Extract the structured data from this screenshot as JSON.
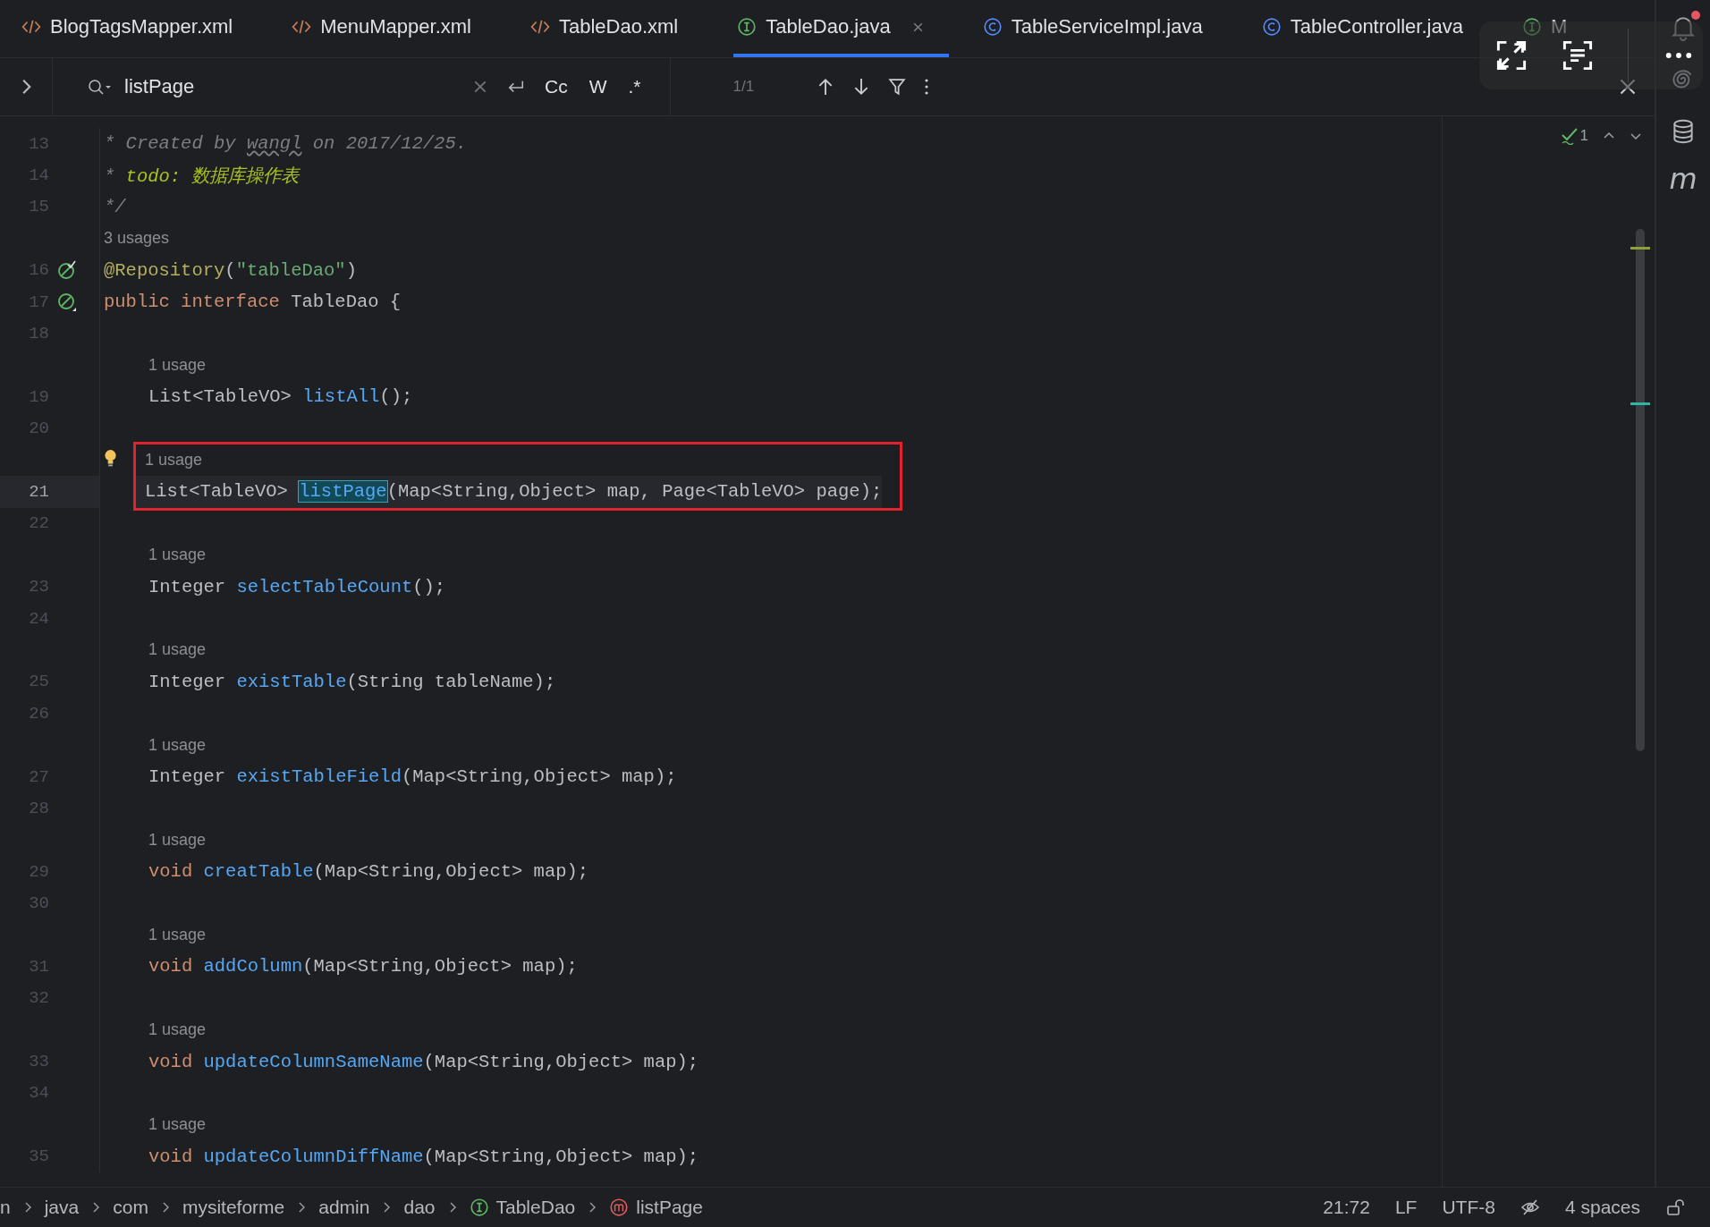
{
  "tabs": [
    {
      "label": "BlogTagsMapper.xml",
      "kind": "xml",
      "selected": false
    },
    {
      "label": "MenuMapper.xml",
      "kind": "xml",
      "selected": false
    },
    {
      "label": "TableDao.xml",
      "kind": "xml",
      "selected": false
    },
    {
      "label": "TableDao.java",
      "kind": "interface",
      "selected": true
    },
    {
      "label": "TableServiceImpl.java",
      "kind": "class",
      "selected": false
    },
    {
      "label": "TableController.java",
      "kind": "class",
      "selected": false
    },
    {
      "label": "M",
      "kind": "interface",
      "selected": false
    }
  ],
  "search": {
    "query": "listPage",
    "options": [
      "Cc",
      "W",
      ".*"
    ],
    "match_count": "1/1"
  },
  "inspection": {
    "count": "1"
  },
  "code": {
    "blocks": [
      {
        "boxed": false,
        "rows": [
          {
            "kind": "code",
            "num": "13",
            "tokens": [
              {
                "text": "* Created by ",
                "kind": "comment"
              },
              {
                "text": "wangl",
                "kind": "comment-typo"
              },
              {
                "text": " on 2017/12/25.",
                "kind": "comment"
              }
            ]
          },
          {
            "kind": "code",
            "num": "14",
            "tokens": [
              {
                "text": "* ",
                "kind": "comment"
              },
              {
                "text": "todo: 数据库操作表",
                "kind": "todo"
              }
            ]
          },
          {
            "kind": "code",
            "num": "15",
            "tokens": [
              {
                "text": "*/",
                "kind": "comment"
              }
            ]
          },
          {
            "kind": "hint",
            "text": "3 usages",
            "indented": false
          },
          {
            "kind": "code",
            "num": "16",
            "gutter": {
              "kind": "bean-check"
            },
            "tokens": [
              {
                "text": "@Repository",
                "kind": "annotation"
              },
              {
                "text": "(",
                "kind": "plain"
              },
              {
                "text": "\"tableDao\"",
                "kind": "string"
              },
              {
                "text": ")",
                "kind": "plain"
              }
            ]
          },
          {
            "kind": "code",
            "num": "17",
            "gutter": {
              "kind": "bean"
            },
            "tokens": [
              {
                "text": "public interface ",
                "kind": "keyword"
              },
              {
                "text": "TableDao {",
                "kind": "plain"
              }
            ]
          },
          {
            "kind": "code",
            "num": "18"
          },
          {
            "kind": "hint",
            "text": "1 usage",
            "indented": true
          },
          {
            "kind": "code",
            "num": "19",
            "indented": true,
            "tokens": [
              {
                "text": "List<TableVO> ",
                "kind": "plain"
              },
              {
                "text": "listAll",
                "kind": "method"
              },
              {
                "text": "();",
                "kind": "plain"
              }
            ]
          },
          {
            "kind": "code",
            "num": "20"
          }
        ]
      },
      {
        "boxed": true,
        "rows": [
          {
            "kind": "hint",
            "text": "1 usage",
            "indented": true,
            "bulb": true
          },
          {
            "kind": "code",
            "num": "21",
            "current": true,
            "indented": true,
            "tokens": [
              {
                "text": "List<TableVO> ",
                "kind": "plain"
              },
              {
                "text": "listPage",
                "kind": "match"
              },
              {
                "text": "(Map<String,Object> map, Page<TableVO> page);",
                "kind": "plain"
              }
            ]
          }
        ]
      },
      {
        "boxed": false,
        "rows": [
          {
            "kind": "code",
            "num": "22"
          },
          {
            "kind": "hint",
            "text": "1 usage",
            "indented": true
          },
          {
            "kind": "code",
            "num": "23",
            "indented": true,
            "tokens": [
              {
                "text": "Integer ",
                "kind": "plain"
              },
              {
                "text": "selectTableCount",
                "kind": "method"
              },
              {
                "text": "();",
                "kind": "plain"
              }
            ]
          },
          {
            "kind": "code",
            "num": "24"
          },
          {
            "kind": "hint",
            "text": "1 usage",
            "indented": true
          },
          {
            "kind": "code",
            "num": "25",
            "indented": true,
            "tokens": [
              {
                "text": "Integer ",
                "kind": "plain"
              },
              {
                "text": "existTable",
                "kind": "method"
              },
              {
                "text": "(String tableName);",
                "kind": "plain"
              }
            ]
          },
          {
            "kind": "code",
            "num": "26"
          },
          {
            "kind": "hint",
            "text": "1 usage",
            "indented": true
          },
          {
            "kind": "code",
            "num": "27",
            "indented": true,
            "tokens": [
              {
                "text": "Integer ",
                "kind": "plain"
              },
              {
                "text": "existTableField",
                "kind": "method"
              },
              {
                "text": "(Map<String,Object> map);",
                "kind": "plain"
              }
            ]
          },
          {
            "kind": "code",
            "num": "28"
          },
          {
            "kind": "hint",
            "text": "1 usage",
            "indented": true
          },
          {
            "kind": "code",
            "num": "29",
            "indented": true,
            "tokens": [
              {
                "text": "void ",
                "kind": "keyword"
              },
              {
                "text": "creatTable",
                "kind": "method"
              },
              {
                "text": "(Map<String,Object> map);",
                "kind": "plain"
              }
            ]
          },
          {
            "kind": "code",
            "num": "30"
          },
          {
            "kind": "hint",
            "text": "1 usage",
            "indented": true
          },
          {
            "kind": "code",
            "num": "31",
            "indented": true,
            "tokens": [
              {
                "text": "void ",
                "kind": "keyword"
              },
              {
                "text": "addColumn",
                "kind": "method"
              },
              {
                "text": "(Map<String,Object> map);",
                "kind": "plain"
              }
            ]
          },
          {
            "kind": "code",
            "num": "32"
          },
          {
            "kind": "hint",
            "text": "1 usage",
            "indented": true
          },
          {
            "kind": "code",
            "num": "33",
            "indented": true,
            "tokens": [
              {
                "text": "void ",
                "kind": "keyword"
              },
              {
                "text": "updateColumnSameName",
                "kind": "method"
              },
              {
                "text": "(Map<String,Object> map);",
                "kind": "plain"
              }
            ]
          },
          {
            "kind": "code",
            "num": "34"
          },
          {
            "kind": "hint",
            "text": "1 usage",
            "indented": true
          },
          {
            "kind": "code",
            "num": "35",
            "indented": true,
            "tokens": [
              {
                "text": "void ",
                "kind": "keyword"
              },
              {
                "text": "updateColumnDiffName",
                "kind": "method"
              },
              {
                "text": "(Map<String,Object> map);",
                "kind": "plain"
              }
            ]
          }
        ]
      }
    ]
  },
  "right_toolbar": {
    "has_notification": true,
    "maven_label": "m"
  },
  "status_bar": {
    "breadcrumbs": [
      {
        "label": "n"
      },
      {
        "label": "java"
      },
      {
        "label": "com"
      },
      {
        "label": "mysiteforme"
      },
      {
        "label": "admin"
      },
      {
        "label": "dao"
      },
      {
        "label": "TableDao",
        "kind": "interface"
      },
      {
        "label": "listPage",
        "kind": "method"
      }
    ],
    "position": "21:72",
    "line_ending": "LF",
    "encoding": "UTF-8",
    "indent": "4 spaces"
  }
}
